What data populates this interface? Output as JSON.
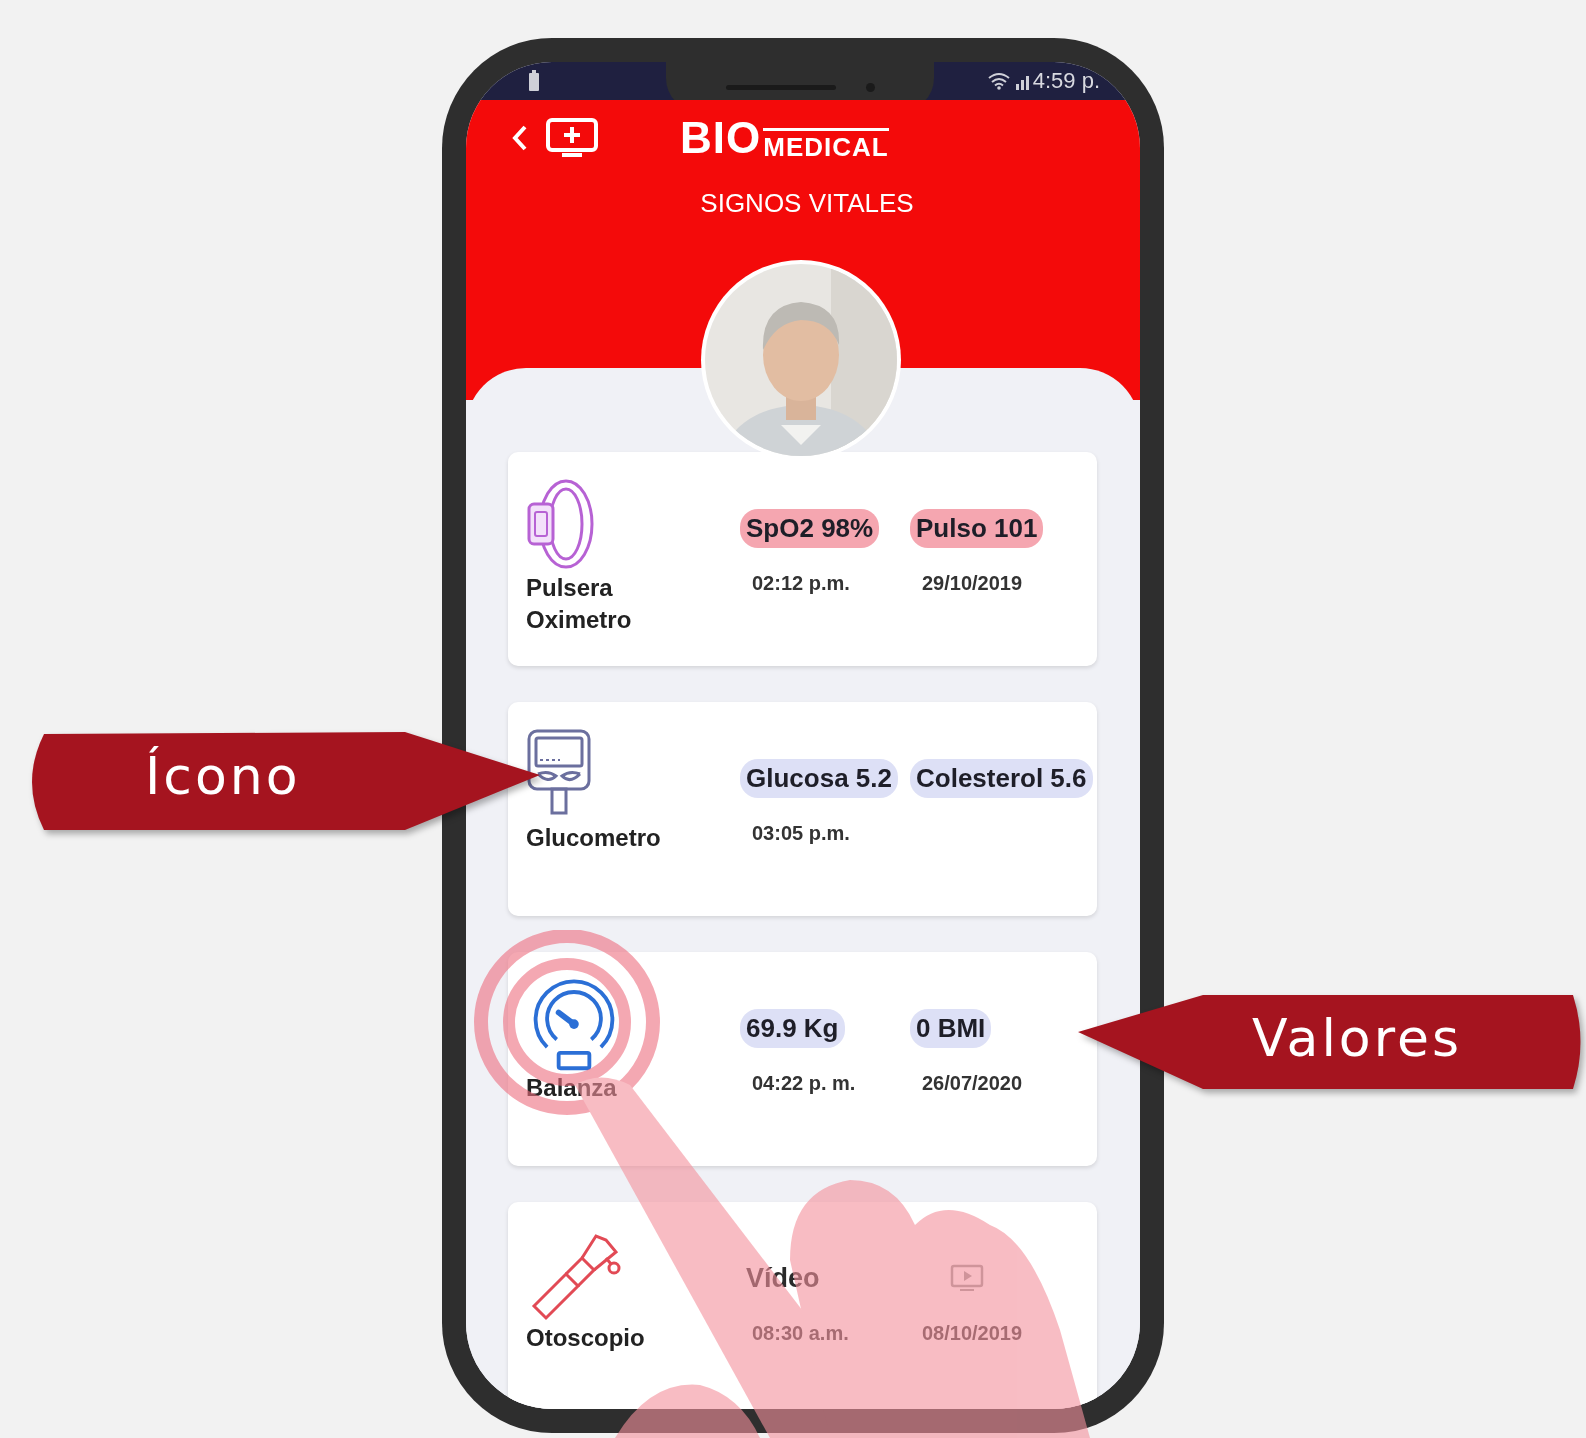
{
  "status_bar": {
    "time": "4:59 p."
  },
  "header": {
    "logo_main": "BIO",
    "logo_sub": "MEDICAL",
    "title": "SIGNOS VITALES"
  },
  "devices": [
    {
      "kind": "oximeter",
      "name": "Pulsera Oximetro",
      "readings": [
        {
          "kind": "pill",
          "label": "SpO2 98%",
          "color": "#f5a6b0"
        },
        {
          "kind": "pill",
          "label": "Pulso 101",
          "color": "#f5a6b0"
        }
      ],
      "time": "02:12 p.m.",
      "date": "29/10/2019"
    },
    {
      "kind": "glucometer",
      "name": "Glucometro",
      "readings": [
        {
          "kind": "pill",
          "label": "Glucosa 5.2",
          "color": "#dde0f6"
        },
        {
          "kind": "pill",
          "label": "Colesterol 5.6",
          "color": "#dde0f6"
        }
      ],
      "time": "03:05 p.m."
    },
    {
      "kind": "scale",
      "name": "Balanza",
      "readings": [
        {
          "kind": "pill",
          "label": "69.9 Kg",
          "color": "#dde0f6"
        },
        {
          "kind": "pill",
          "label": "0 BMI",
          "color": "#dde0f6"
        }
      ],
      "time": "04:22 p. m.",
      "date": "26/07/2020"
    },
    {
      "kind": "otoscope",
      "name": "Otoscopio",
      "readings": [
        {
          "kind": "plain",
          "label": "Vídeo"
        },
        {
          "kind": "video-icon"
        }
      ],
      "time": "08:30 a.m.",
      "date": "08/10/2019"
    }
  ],
  "callouts": [
    {
      "kind": "left",
      "label": "Ícono"
    },
    {
      "kind": "right",
      "label": "Valores"
    }
  ]
}
